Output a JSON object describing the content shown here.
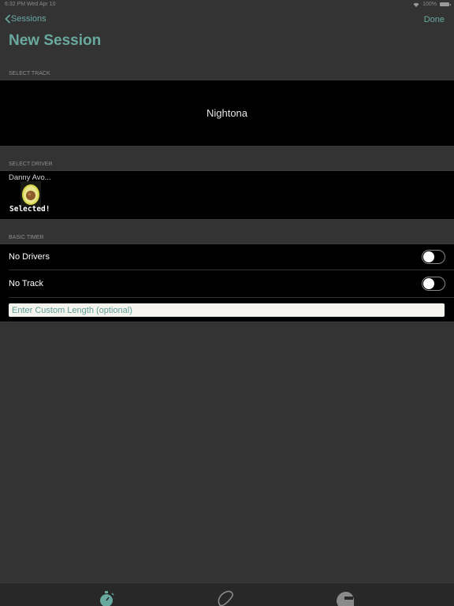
{
  "status_bar": {
    "time_date": "6:32 PM   Wed Apr 10",
    "battery": "100%"
  },
  "nav": {
    "back_label": "Sessions",
    "done_label": "Done",
    "title": "New Session"
  },
  "track_section": {
    "header": "SELECT TRACK",
    "track_name": "Nightona"
  },
  "driver_section": {
    "header": "SELECT DRIVER",
    "driver_name": "Danny Avo...",
    "selected_label": "Selected!",
    "avatar_icon": "avocado-icon"
  },
  "timer_section": {
    "header": "BASIC TIMER",
    "rows": [
      {
        "label": "No Drivers",
        "toggle_on": false
      },
      {
        "label": "No Track",
        "toggle_on": false
      }
    ],
    "custom_length_placeholder": "Enter Custom Length (optional)"
  },
  "tab_bar": {
    "icons": [
      "stopwatch-icon",
      "track-icon",
      "helmet-icon"
    ]
  },
  "colors": {
    "accent": "#6aa9a0",
    "background": "#333333",
    "cell": "#000000"
  }
}
